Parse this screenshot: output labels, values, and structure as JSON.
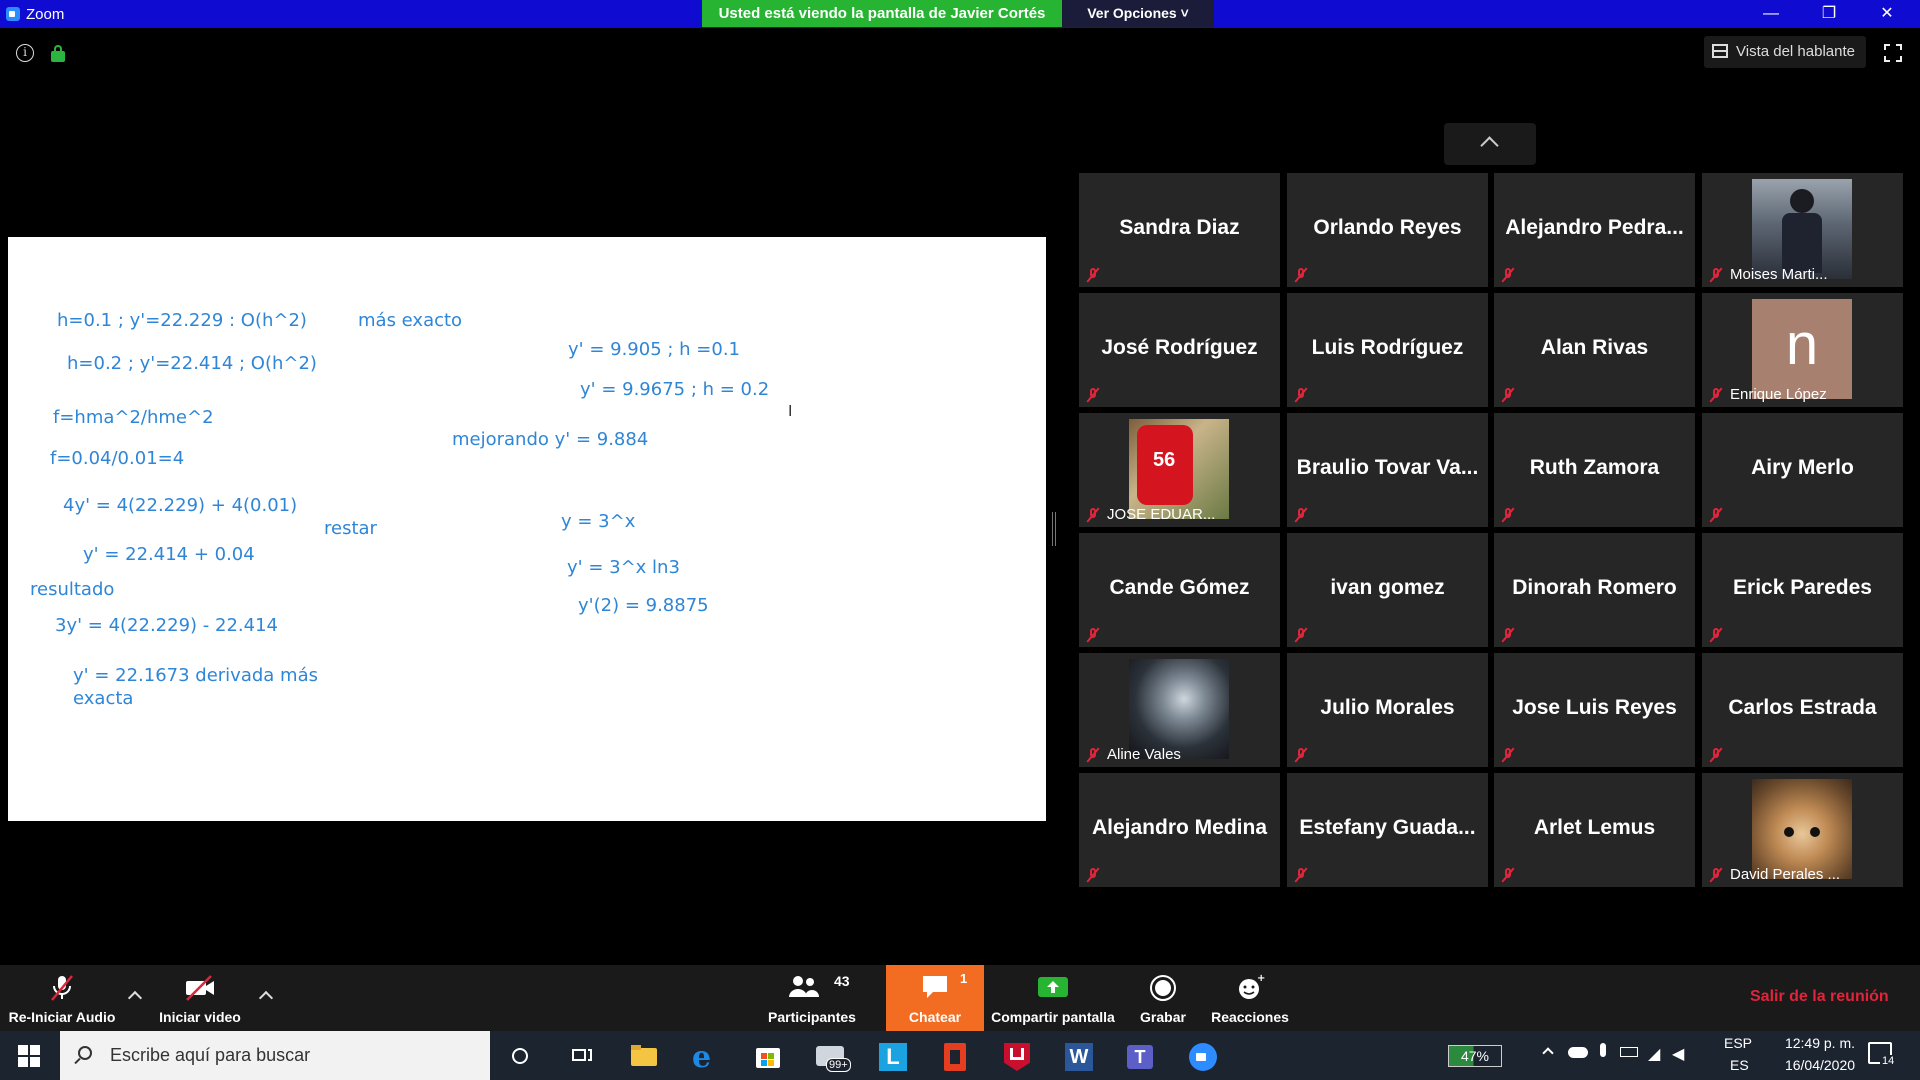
{
  "window": {
    "app_title": "Zoom",
    "share_banner": "Usted está viendo la pantalla de Javier Cortés",
    "view_options": "Ver Opciones ˅",
    "minimize": "—",
    "restore": "❐",
    "close": "✕"
  },
  "top": {
    "speaker_view": "Vista del hablante"
  },
  "whiteboard": {
    "lines": [
      "h=0.1 ; y'=22.229 : O(h^2)",
      "más exacto",
      "h=0.2 ; y'=22.414 ; O(h^2)",
      "f=hma^2/hme^2",
      "f=0.04/0.01=4",
      "4y' = 4(22.229) + 4(0.01)",
      "restar",
      "y' = 22.414 + 0.04",
      "resultado",
      "3y' = 4(22.229) - 22.414",
      "y' = 22.1673 derivada más",
      "exacta",
      "y' = 9.905 ; h =0.1",
      "y' = 9.9675 ; h = 0.2",
      "mejorando y' =  9.884",
      "y = 3^x",
      "y' = 3^x ln3",
      "y'(2) = 9.8875"
    ],
    "cursor": "I"
  },
  "gallery": {
    "participants": [
      {
        "name": "Sandra Diaz",
        "style": "big"
      },
      {
        "name": "Orlando Reyes",
        "style": "big"
      },
      {
        "name": "Alejandro  Pedra...",
        "style": "big"
      },
      {
        "name": "Moises Marti...",
        "style": "photo"
      },
      {
        "name": "José Rodríguez",
        "style": "big"
      },
      {
        "name": "Luis Rodríguez",
        "style": "big"
      },
      {
        "name": "Alan Rivas",
        "style": "big"
      },
      {
        "name": "Enrique López",
        "style": "photo",
        "avatar_letter": "n"
      },
      {
        "name": "JOSE EDUAR...",
        "style": "photo"
      },
      {
        "name": "Braulio  Tovar  Va...",
        "style": "big"
      },
      {
        "name": "Ruth Zamora",
        "style": "big"
      },
      {
        "name": "Airy Merlo",
        "style": "big"
      },
      {
        "name": "Cande Gómez",
        "style": "big"
      },
      {
        "name": "ivan gomez",
        "style": "big"
      },
      {
        "name": "Dinorah Romero",
        "style": "big"
      },
      {
        "name": "Erick Paredes",
        "style": "big"
      },
      {
        "name": "Aline Vales",
        "style": "photo"
      },
      {
        "name": "Julio Morales",
        "style": "big"
      },
      {
        "name": "Jose Luis Reyes",
        "style": "big"
      },
      {
        "name": "Carlos Estrada",
        "style": "big"
      },
      {
        "name": "Alejandro Medina",
        "style": "big"
      },
      {
        "name": "Estefany  Guada...",
        "style": "big"
      },
      {
        "name": "Arlet Lemus",
        "style": "big"
      },
      {
        "name": "David Perales ...",
        "style": "photo"
      }
    ]
  },
  "toolbar": {
    "audio": "Re-Iniciar Audio",
    "video": "Iniciar video",
    "participants": "Participantes",
    "participants_count": "43",
    "chat": "Chatear",
    "chat_count": "1",
    "share": "Compartir pantalla",
    "record": "Grabar",
    "reactions": "Reacciones",
    "leave": "Salir de la reunión"
  },
  "taskbar": {
    "search_placeholder": "Escribe aquí para buscar",
    "mail_badge": "99+",
    "battery": "47%",
    "lang_top": "ESP",
    "lang_bottom": "ES",
    "time": "12:49 p. m.",
    "date": "16/04/2020",
    "notifications": "14"
  },
  "colors": {
    "titlebar": "#0f0bd0",
    "share_banner": "#27b432",
    "whiteboard_text": "#2f86d6",
    "muted": "#e0243b",
    "chat_active": "#f26d21"
  }
}
